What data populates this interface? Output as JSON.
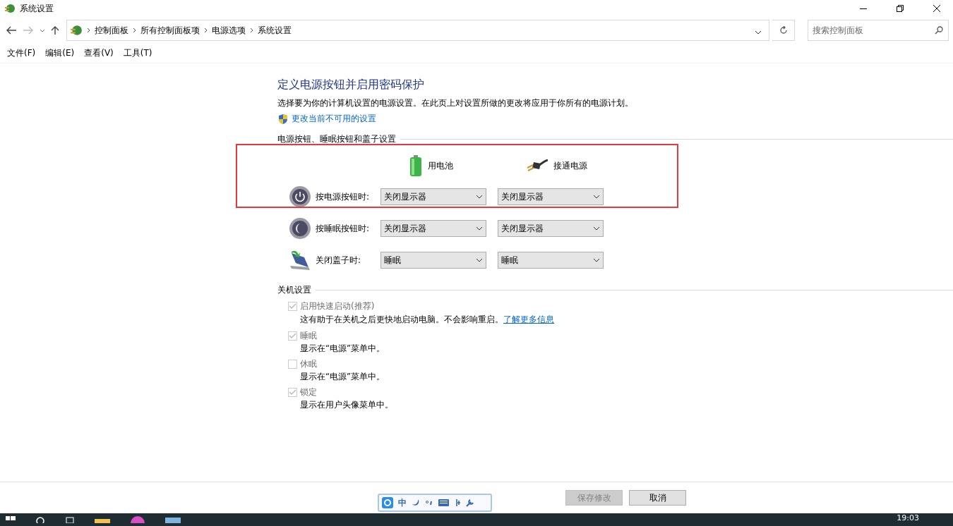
{
  "window": {
    "title": "系统设置"
  },
  "address": {
    "crumbs": [
      "控制面板",
      "所有控制面板项",
      "电源选项",
      "系统设置"
    ]
  },
  "search": {
    "placeholder": "搜索控制面板"
  },
  "menu": [
    "文件(F)",
    "编辑(E)",
    "查看(V)",
    "工具(T)"
  ],
  "heading": "定义电源按钮并启用密码保护",
  "description": "选择要为你的计算机设置的电源设置。在此页上对设置所做的更改将应用于你所有的电源计划。",
  "admin_link": "更改当前不可用的设置",
  "buttons_section": {
    "title": "电源按钮、睡眠按钮和盖子设置",
    "columns": [
      {
        "label": "用电池",
        "kind": "battery"
      },
      {
        "label": "接通电源",
        "kind": "plug"
      }
    ],
    "rows": [
      {
        "label": "按电源按钮时:",
        "kind": "power",
        "values": [
          "关闭显示器",
          "关闭显示器"
        ]
      },
      {
        "label": "按睡眠按钮时:",
        "kind": "sleep",
        "values": [
          "关闭显示器",
          "关闭显示器"
        ]
      },
      {
        "label": "关闭盖子时:",
        "kind": "lid",
        "values": [
          "睡眠",
          "睡眠"
        ]
      }
    ]
  },
  "shutdown_section": {
    "title": "关机设置",
    "options": [
      {
        "label": "启用快速启动(推荐)",
        "checked": true,
        "disabled": true,
        "description": "这有助于在关机之后更快地启动电脑。不会影响重启。",
        "link": "了解更多信息"
      },
      {
        "label": "睡眠",
        "checked": true,
        "disabled": true,
        "description": "显示在“电源”菜单中。"
      },
      {
        "label": "休眠",
        "checked": false,
        "disabled": true,
        "description": "显示在“电源”菜单中。"
      },
      {
        "label": "锁定",
        "checked": true,
        "disabled": true,
        "description": "显示在用户头像菜单中。"
      }
    ]
  },
  "footer_buttons": [
    {
      "label": "保存修改",
      "disabled": true
    },
    {
      "label": "取消",
      "disabled": false
    }
  ],
  "ime": {
    "mode": "中"
  },
  "taskbar": {
    "clock": "19:03"
  }
}
